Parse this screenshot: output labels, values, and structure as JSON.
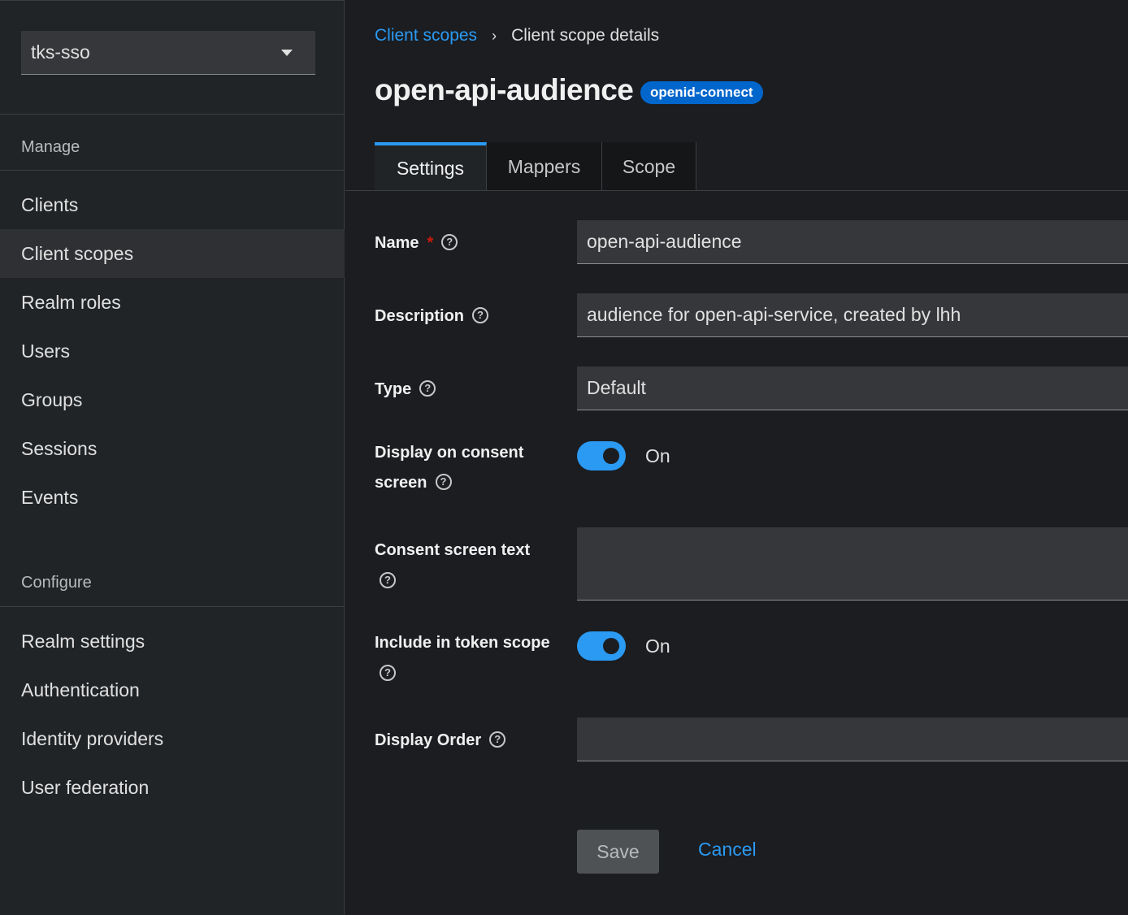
{
  "sidebar": {
    "realm": "tks-sso",
    "sections": [
      {
        "title": "Manage"
      },
      {
        "title": "Configure"
      }
    ],
    "manage_items": [
      "Clients",
      "Client scopes",
      "Realm roles",
      "Users",
      "Groups",
      "Sessions",
      "Events"
    ],
    "configure_items": [
      "Realm settings",
      "Authentication",
      "Identity providers",
      "User federation"
    ],
    "active_item": "Client scopes"
  },
  "breadcrumb": {
    "parent": "Client scopes",
    "separator": "›",
    "current": "Client scope details"
  },
  "header": {
    "title": "open-api-audience",
    "badge": "openid-connect"
  },
  "tabs": [
    "Settings",
    "Mappers",
    "Scope"
  ],
  "active_tab": "Settings",
  "form": {
    "name": {
      "label": "Name",
      "required_mark": "*",
      "value": "open-api-audience"
    },
    "description": {
      "label": "Description",
      "value": "audience for open-api-service, created by lhh"
    },
    "type": {
      "label": "Type",
      "value": "Default"
    },
    "display_on_consent": {
      "label_line1": "Display on consent",
      "label_line2": "screen",
      "state": "On"
    },
    "consent_text": {
      "label": "Consent screen text",
      "value": ""
    },
    "include_in_token": {
      "label": "Include in token scope",
      "state": "On"
    },
    "display_order": {
      "label": "Display Order",
      "value": ""
    }
  },
  "buttons": {
    "save": "Save",
    "cancel": "Cancel"
  },
  "help_glyph": "?",
  "colors": {
    "accent": "#2b9af3",
    "badge": "#0066cc",
    "required": "#c9190b"
  }
}
